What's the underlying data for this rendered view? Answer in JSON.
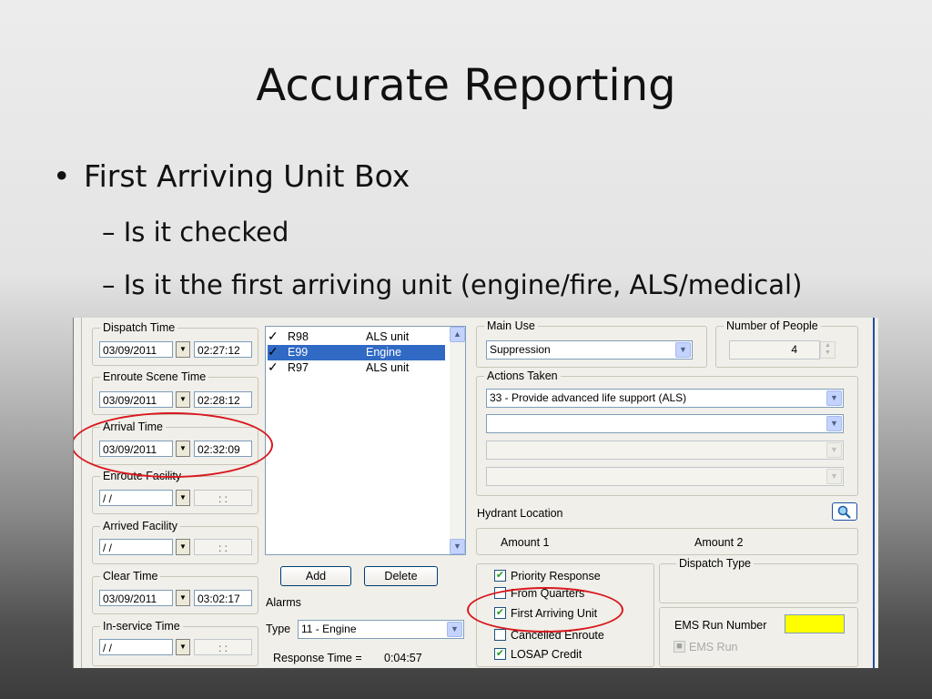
{
  "slide": {
    "title": "Accurate Reporting",
    "bullet_glyph": "•",
    "bullet": "First Arriving Unit Box",
    "subbullets": [
      "– Is it checked",
      "– Is it the first arriving unit (engine/fire, ALS/medical)"
    ]
  },
  "colors": {
    "accent_select": "#316ac5",
    "highlight_ring": "#d8171e",
    "ems_field": "#ffff00",
    "check": "#21a121"
  },
  "form": {
    "dispatch_time": {
      "label": "Dispatch Time",
      "date": "03/09/2011",
      "time": "02:27:12"
    },
    "enroute_scene_time": {
      "label": "Enroute Scene Time",
      "date": "03/09/2011",
      "time": "02:28:12"
    },
    "arrival_time": {
      "label": "Arrival Time",
      "date": "03/09/2011",
      "time": "02:32:09"
    },
    "enroute_facility": {
      "label": "Enroute Facility",
      "date": " / /",
      "time": ": :"
    },
    "arrived_facility": {
      "label": "Arrived Facility",
      "date": " / /",
      "time": ": :"
    },
    "clear_time": {
      "label": "Clear Time",
      "date": "03/09/2011",
      "time": "03:02:17"
    },
    "inservice_time": {
      "label": "In-service Time",
      "date": " / /",
      "time": ": :"
    },
    "units": [
      {
        "id": "R98",
        "type": "ALS unit",
        "checked": true,
        "selected": false
      },
      {
        "id": "E99",
        "type": "Engine",
        "checked": true,
        "selected": true
      },
      {
        "id": "R97",
        "type": "ALS unit",
        "checked": true,
        "selected": false
      }
    ],
    "add_label": "Add",
    "delete_label": "Delete",
    "alarms_label": "Alarms",
    "type_label": "Type",
    "type_value": "11 - Engine",
    "response_time_label": "Response Time =",
    "response_time_value": "0:04:57",
    "main_use_label": "Main Use",
    "main_use_value": "Suppression",
    "people_label": "Number of People",
    "people_value": "4",
    "actions_label": "Actions Taken",
    "action_1": "33 - Provide advanced life support (ALS)",
    "hydrant_label": "Hydrant Location",
    "amount1_label": "Amount 1",
    "amount2_label": "Amount 2",
    "checkboxes": [
      {
        "label": "Priority Response",
        "checked": true
      },
      {
        "label": "From Quarters",
        "checked": false
      },
      {
        "label": "First Arriving Unit",
        "checked": true
      },
      {
        "label": "Cancelled Enroute",
        "checked": false
      },
      {
        "label": "LOSAP Credit",
        "checked": true
      }
    ],
    "dispatch_type_label": "Dispatch Type",
    "ems_run_number_label": "EMS Run Number",
    "ems_run_label": "EMS Run",
    "icons": {
      "dropdown": "chevron-down-icon",
      "search": "magnifier-icon",
      "check": "checkmark-icon",
      "spin": "spin-updown-icon"
    }
  }
}
